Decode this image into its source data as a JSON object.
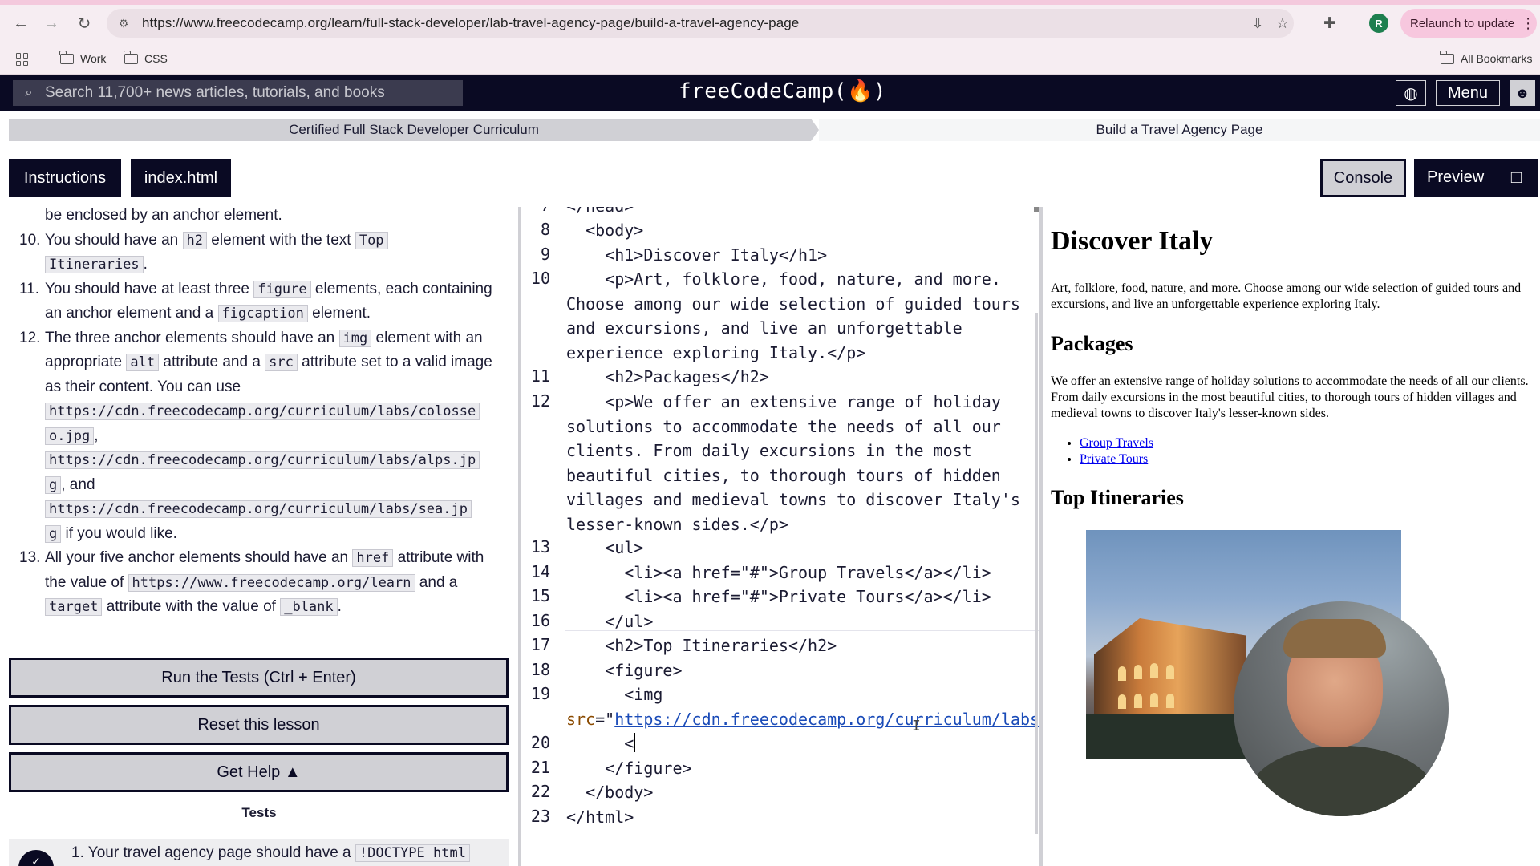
{
  "browser": {
    "url": "https://www.freecodecamp.org/learn/full-stack-developer/lab-travel-agency-page/build-a-travel-agency-page",
    "profile_initial": "R",
    "relaunch_label": "Relaunch to update",
    "bookmarks": [
      "Work",
      "CSS"
    ],
    "all_bookmarks_label": "All Bookmarks"
  },
  "fcc_nav": {
    "search_placeholder": "Search 11,700+ news articles, tutorials, and books",
    "logo": "freeCodeCamp(🔥)",
    "menu_label": "Menu"
  },
  "breadcrumb": {
    "curriculum": "Certified Full Stack Developer Curriculum",
    "lesson": "Build a Travel Agency Page"
  },
  "tabs": {
    "instructions": "Instructions",
    "file": "index.html",
    "console": "Console",
    "preview": "Preview"
  },
  "instructions": {
    "item9_tail": "be enclosed by an anchor element.",
    "item10": {
      "num": "10.",
      "a": "You should have an ",
      "code1": "h2",
      "b": " element with the text ",
      "code2": "Top",
      "code2b": "Itineraries",
      "c": "."
    },
    "item11": {
      "num": "11.",
      "a": "You should have at least three ",
      "code1": "figure",
      "b": " elements, each containing an anchor element and a ",
      "code2": "figcaption",
      "c": " element."
    },
    "item12": {
      "num": "12.",
      "a": "The three anchor elements should have an ",
      "code1": "img",
      "b": " element with an appropriate ",
      "code2": "alt",
      "c": " attribute and a ",
      "code3": "src",
      "d": " attribute set to a valid image as their content. You can use",
      "url1a": "https://cdn.freecodecamp.org/curriculum/labs/colosse",
      "url1b": "o.jpg",
      "sep1": ",",
      "url2a": "https://cdn.freecodecamp.org/curriculum/labs/alps.jp",
      "url2b": "g",
      "sep2": ", and",
      "url3a": "https://cdn.freecodecamp.org/curriculum/labs/sea.jp",
      "url3b": "g",
      "e": " if you would like."
    },
    "item13": {
      "num": "13.",
      "a": "All your five anchor elements should have an ",
      "code1": "href",
      "b": " attribute with the value of ",
      "code2": "https://www.freecodecamp.org/learn",
      "c": " and a ",
      "code3": "target",
      "d": " attribute with the value of ",
      "code4": "_blank",
      "e": "."
    }
  },
  "actions": {
    "run": "Run the Tests (Ctrl + Enter)",
    "reset": "Reset this lesson",
    "help": "Get Help ▲"
  },
  "tests": {
    "heading": "Tests",
    "first_num": "1.",
    "first_text": "Your travel agency page should have a ",
    "first_code": "!DOCTYPE html"
  },
  "editor": {
    "top_partial": "</head>",
    "lines": [
      {
        "n": "8",
        "text": "  <body>"
      },
      {
        "n": "9",
        "text": "    <h1>Discover Italy</h1>"
      },
      {
        "n": "10",
        "text": "    <p>Art, folklore, food, nature, and more. Choose among our wide selection of guided tours and excursions, and live an unforgettable experience exploring Italy.</p>"
      },
      {
        "n": "11",
        "text": "    <h2>Packages</h2>"
      },
      {
        "n": "12",
        "text": "    <p>We offer an extensive range of holiday solutions to accommodate the needs of all our clients. From daily excursions in the most beautiful cities, to thorough tours of hidden villages and medieval towns to discover Italy's lesser-known sides.</p>"
      },
      {
        "n": "13",
        "text": "    <ul>"
      },
      {
        "n": "14",
        "text": "      <li><a href=\"#\">Group Travels</a></li>"
      },
      {
        "n": "15",
        "text": "      <li><a href=\"#\">Private Tours</a></li>"
      },
      {
        "n": "16",
        "text": "    </ul>"
      },
      {
        "n": "17",
        "text": "    <h2>Top Itineraries</h2>"
      },
      {
        "n": "18",
        "text": "    <figure>"
      },
      {
        "n": "19",
        "text": "      <img src=\"https://cdn.freecodecamp.org/curriculum/labs/colosseo.jpg\">"
      },
      {
        "n": "20",
        "text": "      <"
      },
      {
        "n": "21",
        "text": "    </figure>"
      },
      {
        "n": "22",
        "text": "  </body>"
      },
      {
        "n": "23",
        "text": "</html>"
      }
    ],
    "img_url_part1": "https://cdn.freecodecamp.org/",
    "img_url_part2": "curriculum/labs/colosseo.jpg"
  },
  "preview": {
    "h1": "Discover Italy",
    "p1": "Art, folklore, food, nature, and more. Choose among our wide selection of guided tours and excursions, and live an unforgettable experience exploring Italy.",
    "h2_packages": "Packages",
    "p2": "We offer an extensive range of holiday solutions to accommodate the needs of all our clients. From daily excursions in the most beautiful cities, to thorough tours of hidden villages and medieval towns to discover Italy's lesser-known sides.",
    "links": [
      "Group Travels",
      "Private Tours"
    ],
    "h2_itineraries": "Top Itineraries"
  },
  "colors": {
    "fcc_dark": "#0a0a23",
    "fcc_gray": "#d0d0d5",
    "relaunch_bg": "#f7c7de",
    "link_blue": "#0000ee",
    "attr_color": "#8a4a00"
  },
  "icons": {
    "back": "arrow-left-icon",
    "forward": "arrow-right-icon",
    "reload": "reload-icon",
    "site_info": "tune-icon",
    "install": "install-icon",
    "bookmark_star": "star-icon",
    "extensions": "puzzle-icon",
    "apps": "apps-grid-icon",
    "folder": "folder-icon",
    "search": "search-icon",
    "globe": "globe-icon",
    "user": "user-icon",
    "popout": "popout-icon",
    "caret_up": "caret-up-icon"
  }
}
